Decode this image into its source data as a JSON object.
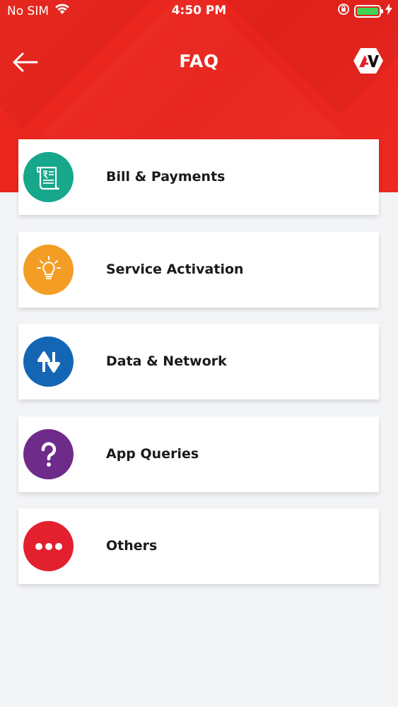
{
  "status_bar": {
    "carrier": "No SIM",
    "time": "4:50 PM",
    "battery_percent": 100
  },
  "header": {
    "title": "FAQ",
    "back_icon": "arrow-left-icon",
    "logo_icon": "brand-logo-icon"
  },
  "colors": {
    "header_red": "#ea251e",
    "background": "#f3f4f6",
    "bill_green": "#17a78b",
    "service_orange": "#f49d25",
    "data_blue": "#1565b5",
    "app_purple": "#6e2b8a",
    "others_red": "#e3202e"
  },
  "faq_items": [
    {
      "label": "Bill & Payments",
      "icon": "bill-receipt-icon"
    },
    {
      "label": "Service Activation",
      "icon": "lightbulb-icon"
    },
    {
      "label": "Data & Network",
      "icon": "up-down-arrows-icon"
    },
    {
      "label": "App Queries",
      "icon": "question-mark-icon"
    },
    {
      "label": "Others",
      "icon": "more-dots-icon"
    }
  ]
}
